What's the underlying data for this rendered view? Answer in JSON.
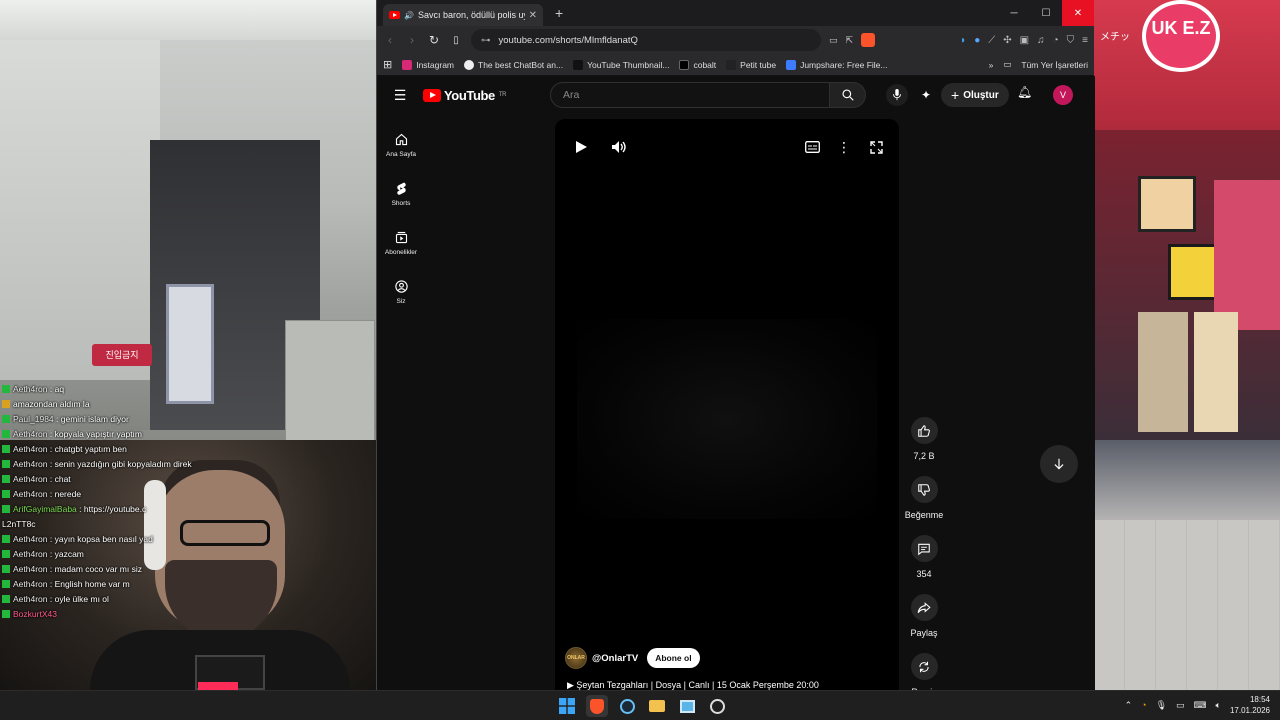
{
  "browser": {
    "tab_title": "Savcı baron, ödüllü polis uyu",
    "url": "youtube.com/shorts/MlmfldanatQ",
    "bookmarks": [
      {
        "label": "Instagram",
        "color": "#d62976"
      },
      {
        "label": "The best ChatBot an...",
        "color": "#888888"
      },
      {
        "label": "YouTube Thumbnail...",
        "color": "#1a1a1a"
      },
      {
        "label": "cobalt",
        "color": "#222222"
      },
      {
        "label": "Petit tube",
        "color": "#333333"
      },
      {
        "label": "Jumpshare: Free File...",
        "color": "#3d7bff"
      }
    ],
    "all_bookmarks_label": "Tüm Yer İşaretleri"
  },
  "youtube": {
    "logo_text": "YouTube",
    "logo_region": "TR",
    "search_placeholder": "Ara",
    "create_label": "Oluştur",
    "avatar_letter": "V",
    "sidebar": [
      {
        "label": "Ana Sayfa",
        "icon": "home-icon"
      },
      {
        "label": "Shorts",
        "icon": "shorts-icon"
      },
      {
        "label": "Abonelikler",
        "icon": "subscriptions-icon"
      },
      {
        "label": "Siz",
        "icon": "account-icon"
      }
    ],
    "short": {
      "channel": "@OnlarTV",
      "subscribe_label": "Abone ol",
      "title": "Şeytan Tezgahları | Dosya | Canlı | 15 Ocak Perşembe 20:00",
      "likes": "7,2 B",
      "dislike_label": "Beğenme",
      "comments": "354",
      "share_label": "Paylaş",
      "remix_label": "Remix"
    }
  },
  "chat": [
    {
      "user": "Aeth4ron",
      "text": "aq",
      "color": "user"
    },
    {
      "user": "",
      "text": "amazondan aldım la",
      "color": "user-pink"
    },
    {
      "user": "Paul_1984",
      "text": "gemini islam diyor",
      "color": "user"
    },
    {
      "user": "Aeth4ron",
      "text": "kopyala yapıştır yaptım",
      "color": "user"
    },
    {
      "user": "Aeth4ron",
      "text": "chatgbt yaptım ben",
      "color": "user"
    },
    {
      "user": "Aeth4ron",
      "text": "senin yazdığın gibi kopyaladım direk",
      "color": "user"
    },
    {
      "user": "Aeth4ron",
      "text": "chat",
      "color": "user"
    },
    {
      "user": "Aeth4ron",
      "text": "nerede",
      "color": "user"
    },
    {
      "user": "ArifGayimalBaba",
      "text": "https://youtube.c",
      "color": "user-green"
    },
    {
      "user": "",
      "text": "L2nTT8c",
      "color": "user"
    },
    {
      "user": "Aeth4ron",
      "text": "yayın kopsa ben nasıl yad",
      "color": "user"
    },
    {
      "user": "Aeth4ron",
      "text": "yazcam",
      "color": "user"
    },
    {
      "user": "Aeth4ron",
      "text": "madam coco var mı siz",
      "color": "user"
    },
    {
      "user": "Aeth4ron",
      "text": "English home var m",
      "color": "user"
    },
    {
      "user": "Aeth4ron",
      "text": "oyle ülke mı ol",
      "color": "user"
    },
    {
      "user": "BozkurtX43",
      "text": "",
      "color": "user-pink"
    }
  ],
  "scene": {
    "left_sign": "진입금지",
    "right_logo": "UK E.Z",
    "right_kana": "メチッ"
  },
  "taskbar": {
    "time": "18:54",
    "date": "17.01.2026"
  }
}
